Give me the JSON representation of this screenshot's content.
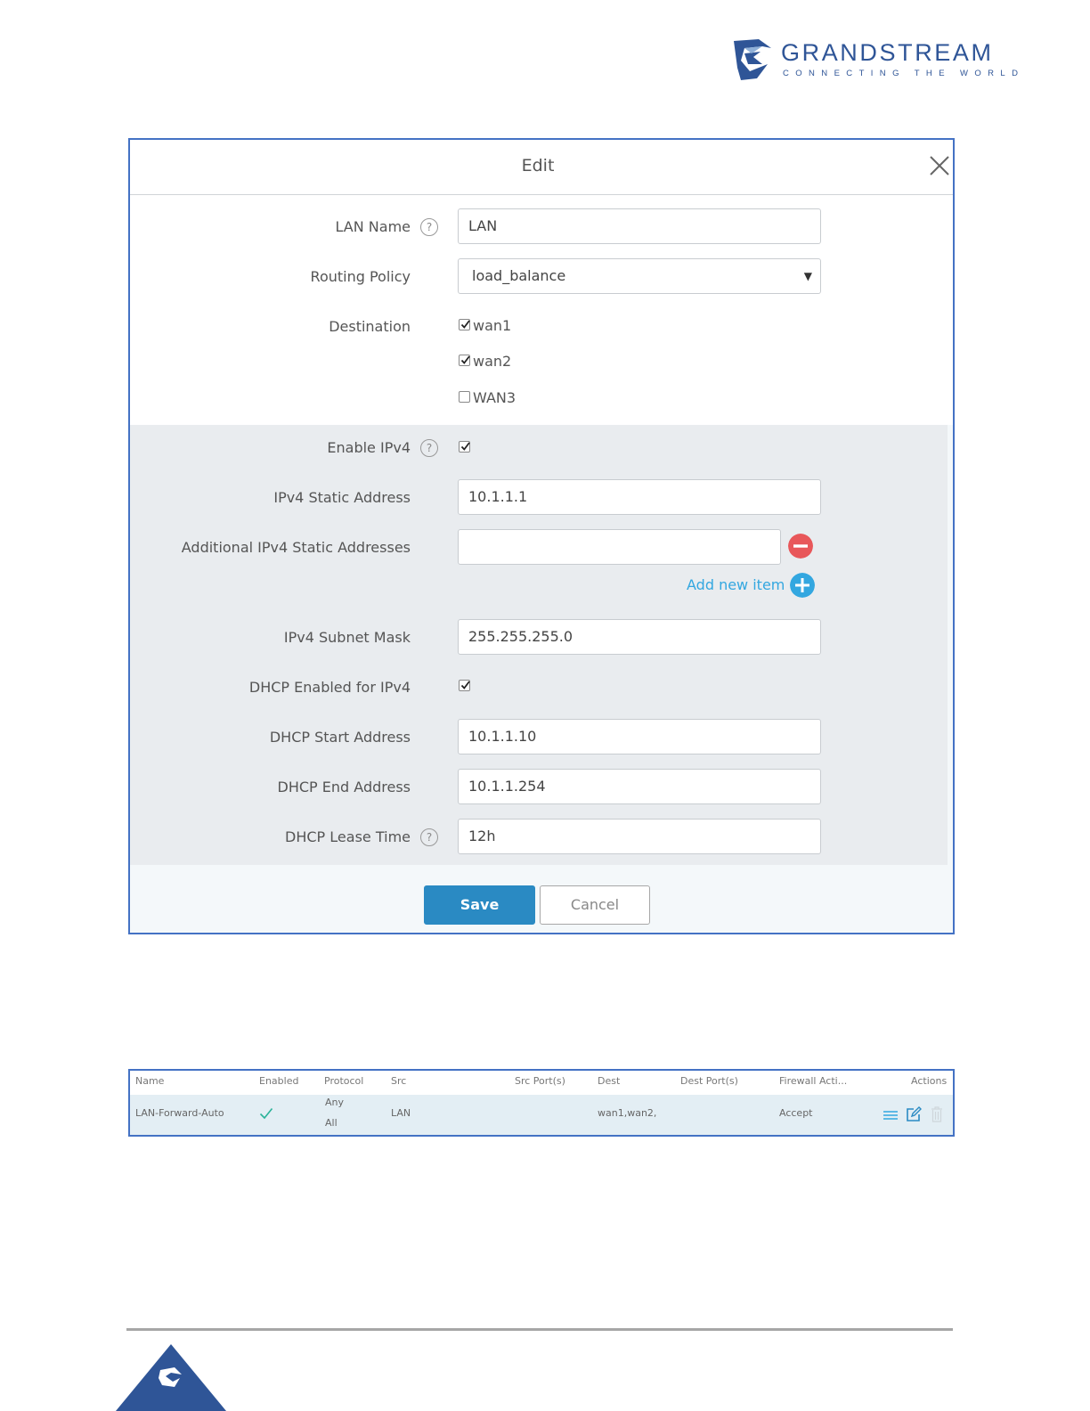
{
  "brand": {
    "name": "GRANDSTREAM",
    "tagline": "CONNECTING THE WORLD",
    "color": "#2f5597"
  },
  "dialog": {
    "title": "Edit",
    "fields": {
      "lan_name": {
        "label": "LAN Name",
        "value": "LAN"
      },
      "routing_policy": {
        "label": "Routing Policy",
        "value": "load_balance"
      },
      "destination": {
        "label": "Destination",
        "options": [
          {
            "label": "wan1",
            "checked": true
          },
          {
            "label": "wan2",
            "checked": true
          },
          {
            "label": "WAN3",
            "checked": false
          }
        ]
      },
      "enable_ipv4": {
        "label": "Enable IPv4",
        "checked": true
      },
      "ipv4_static": {
        "label": "IPv4 Static Address",
        "value": "10.1.1.1"
      },
      "additional_ipv4": {
        "label": "Additional IPv4 Static Addresses",
        "value": ""
      },
      "add_new_item": "Add new item",
      "ipv4_mask": {
        "label": "IPv4 Subnet Mask",
        "value": "255.255.255.0"
      },
      "dhcp_enabled": {
        "label": "DHCP Enabled for IPv4",
        "checked": true
      },
      "dhcp_start": {
        "label": "DHCP Start Address",
        "value": "10.1.1.10"
      },
      "dhcp_end": {
        "label": "DHCP End Address",
        "value": "10.1.1.254"
      },
      "dhcp_lease": {
        "label": "DHCP Lease Time",
        "value": "12h"
      }
    },
    "buttons": {
      "save": "Save",
      "cancel": "Cancel"
    }
  },
  "table": {
    "headers": [
      "Name",
      "Enabled",
      "Protocol",
      "Src",
      "Src Port(s)",
      "Dest",
      "Dest Port(s)",
      "Firewall Acti...",
      "Actions"
    ],
    "rows": [
      {
        "name": "LAN-Forward-Auto",
        "enabled": true,
        "protocol_1": "Any",
        "protocol_2": "All",
        "src": "LAN",
        "src_ports": "",
        "dest": "wan1,wan2,",
        "dest_ports": "",
        "firewall_action": "Accept"
      }
    ]
  },
  "colors": {
    "accent": "#2a8ac3",
    "link": "#33a7e0",
    "remove": "#e8575a",
    "border": "#4472c4",
    "check": "#2bb39a"
  }
}
